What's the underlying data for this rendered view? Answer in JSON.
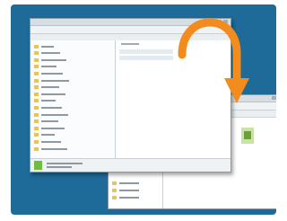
{
  "background_color": "#1e6b99",
  "arrow_color": "#f28c1c",
  "icons": [
    "folder-icon",
    "curved-arrow-icon",
    "image-file-icon"
  ],
  "front_window": {
    "tree_items": 16,
    "file_rows": 2
  },
  "back_window": {
    "tree_items": 3
  }
}
